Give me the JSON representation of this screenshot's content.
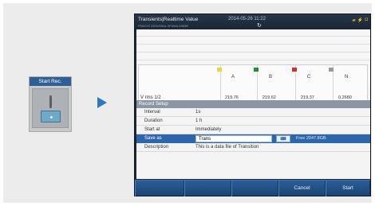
{
  "widget": {
    "title": "Start Rec."
  },
  "screen": {
    "title": "Transients|Realtime Value",
    "datetime": "2014-05-26 11:22",
    "subtitle": "P30/070     230V/50Hz     3P4W/L2/NNR",
    "status_icons": [
      "plug-icon",
      "usb-icon",
      "battery-icon"
    ],
    "channels": [
      {
        "label": "A",
        "color": "#e8d92b"
      },
      {
        "label": "B",
        "color": "#1e8e3a"
      },
      {
        "label": "C",
        "color": "#d92b2b"
      },
      {
        "label": "N",
        "color": "#9a9a9a"
      }
    ],
    "row": {
      "label": "V rms 1/2",
      "values": [
        "219.76",
        "219.62",
        "219.37",
        "0.2680"
      ]
    },
    "setup": {
      "header": "Record Setup",
      "rows": [
        {
          "label": "Interval",
          "value": "1s"
        },
        {
          "label": "Duration",
          "value": "1 h"
        },
        {
          "label": "Start at",
          "value": "Immediately"
        }
      ],
      "save_as": {
        "label": "Save as",
        "value": "Trans",
        "free": "Free 2047.8GB"
      },
      "description": {
        "label": "Description",
        "value": "This is a data file of Transition"
      }
    },
    "buttons": {
      "cancel": "Cancel",
      "start": "Start"
    }
  }
}
